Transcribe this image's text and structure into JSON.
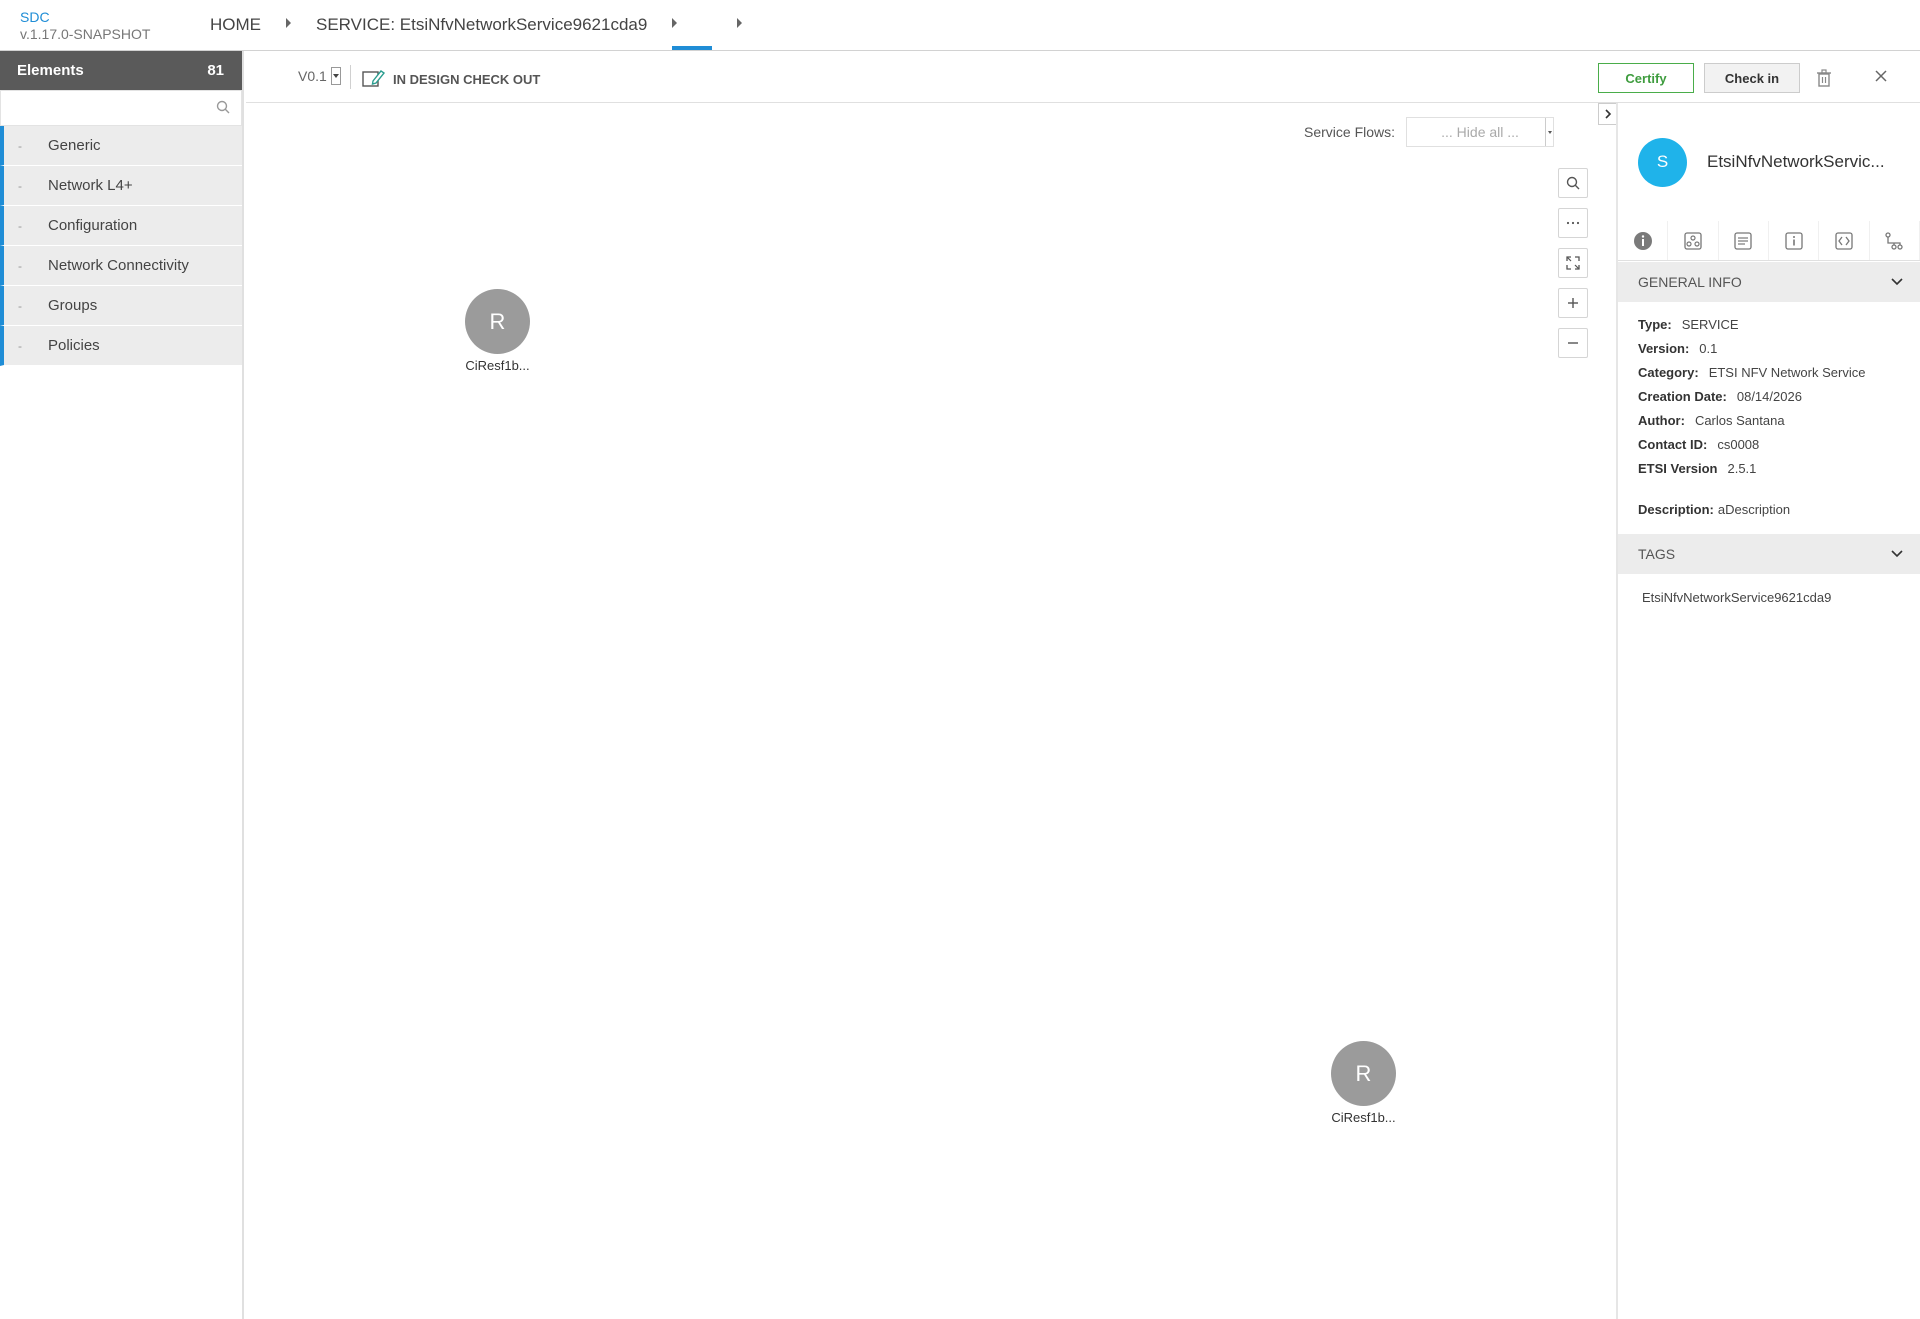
{
  "header": {
    "app_name": "SDC",
    "app_version": "v.1.17.0-SNAPSHOT",
    "breadcrumb": [
      {
        "label": "HOME"
      },
      {
        "label": "SERVICE: EtsiNfvNetworkService9621cda9"
      },
      {
        "label": ""
      }
    ]
  },
  "palette": {
    "title": "Elements",
    "count": "81",
    "search_placeholder": "",
    "groups": [
      {
        "dash": "-",
        "label": "Generic"
      },
      {
        "dash": "-",
        "label": "Network L4+"
      },
      {
        "dash": "-",
        "label": "Configuration"
      },
      {
        "dash": "-",
        "label": "Network Connectivity"
      },
      {
        "dash": "-",
        "label": "Groups"
      },
      {
        "dash": "-",
        "label": "Policies"
      }
    ]
  },
  "workspace": {
    "version": "V0.1",
    "lifecycle_state": "IN DESIGN CHECK OUT",
    "certify_label": "Certify",
    "checkin_label": "Check in"
  },
  "canvas": {
    "service_flows_label": "Service Flows:",
    "service_flows_value": "... Hide all ...",
    "nodes": [
      {
        "initial": "R",
        "label": "CiResf1b..."
      },
      {
        "initial": "R",
        "label": "CiResf1b..."
      }
    ]
  },
  "details": {
    "avatar_initial": "S",
    "title": "EtsiNfvNetworkServic...",
    "general_info_label": "GENERAL INFO",
    "fields": [
      {
        "key": "Type:",
        "value": "SERVICE"
      },
      {
        "key": "Version:",
        "value": "0.1"
      },
      {
        "key": "Category:",
        "value": "ETSI NFV Network Service"
      },
      {
        "key": "Creation Date:",
        "value": "08/14/2026"
      },
      {
        "key": "Author:",
        "value": "Carlos Santana"
      },
      {
        "key": "Contact ID:",
        "value": "cs0008"
      },
      {
        "key": "ETSI Version",
        "value": "2.5.1"
      }
    ],
    "description_key": "Description:",
    "description_value": "aDescription",
    "tags_label": "TAGS",
    "tags": [
      "EtsiNfvNetworkService9621cda9"
    ]
  },
  "colors": {
    "accent": "#1f8dd6",
    "certify": "#3e9c3e",
    "avatar": "#1fb3ea",
    "node": "#9b9b9b"
  }
}
